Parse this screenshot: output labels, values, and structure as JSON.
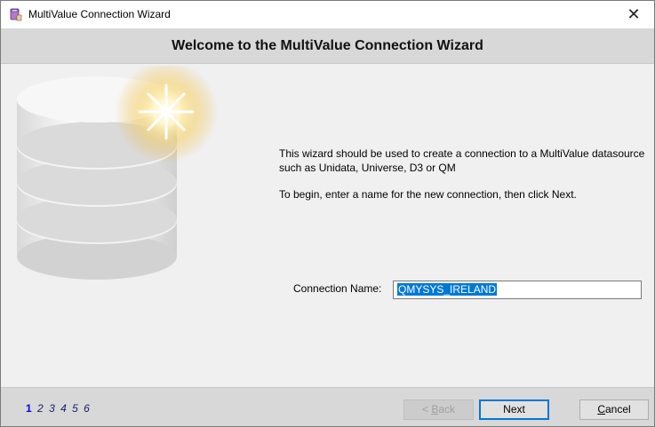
{
  "window": {
    "title": "MultiValue Connection Wizard",
    "close_glyph": "✕",
    "app_icon": "database-wizard-icon"
  },
  "header": {
    "title": "Welcome to the MultiValue Connection Wizard"
  },
  "intro": {
    "line1": "This wizard should be used to create a connection to a MultiValue datasource",
    "line2": "such as Unidata, Universe, D3 or QM",
    "instruction": "To begin, enter a name for the new connection, then click Next."
  },
  "connection": {
    "label": "Connection Name:",
    "value": "QMYSYS_IRELAND"
  },
  "steps": {
    "items": [
      "1",
      "2",
      "3",
      "4",
      "5",
      "6"
    ],
    "current": "1"
  },
  "buttons": {
    "back_prefix": "< ",
    "back_access": "B",
    "back_rest": "ack",
    "next": "Next",
    "cancel_access": "C",
    "cancel_rest": "ancel"
  },
  "colors": {
    "accent": "#0078d7",
    "step_active": "#0000ee"
  }
}
